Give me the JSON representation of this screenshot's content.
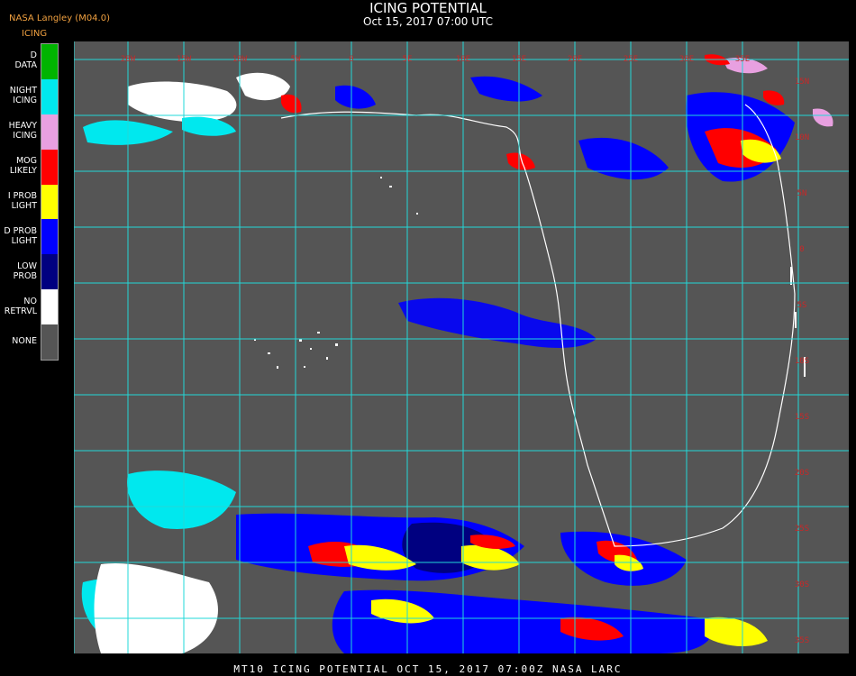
{
  "header": {
    "title": "ICING POTENTIAL",
    "subtitle": "Oct 15, 2017 07:00 UTC",
    "producer": "NASA Langley (M04.0)",
    "legend_title": "ICING"
  },
  "legend": [
    {
      "label": "D DATA",
      "color": "#00b400"
    },
    {
      "label": "NIGHT ICING",
      "color": "#00e8ee"
    },
    {
      "label": "HEAVY ICING",
      "color": "#e8a0e0"
    },
    {
      "label": "MOG LIKELY",
      "color": "#ff0000"
    },
    {
      "label": "I PROB LIGHT",
      "color": "#ffff00"
    },
    {
      "label": "D PROB LIGHT",
      "color": "#0000ff"
    },
    {
      "label": "LOW PROB",
      "color": "#000080"
    },
    {
      "label": "NO RETRVL",
      "color": "#ffffff"
    },
    {
      "label": "NONE",
      "color": "#555555"
    }
  ],
  "map": {
    "background_color": "#555555",
    "grid_color": "#22d8d8",
    "coast_color": "#ffffff",
    "lon_labels": [
      "20W",
      "15W",
      "10W",
      "5W",
      "0",
      "5E",
      "10E",
      "15E",
      "20E",
      "25E",
      "30E",
      "35E"
    ],
    "lat_labels": [
      "15N",
      "10N",
      "5N",
      "0",
      "5S",
      "10S",
      "15S",
      "20S",
      "25S",
      "30S",
      "35S",
      "40S"
    ]
  },
  "footer": "MT10  ICING POTENTIAL   OCT 15, 2017 07:00Z   NASA LARC"
}
